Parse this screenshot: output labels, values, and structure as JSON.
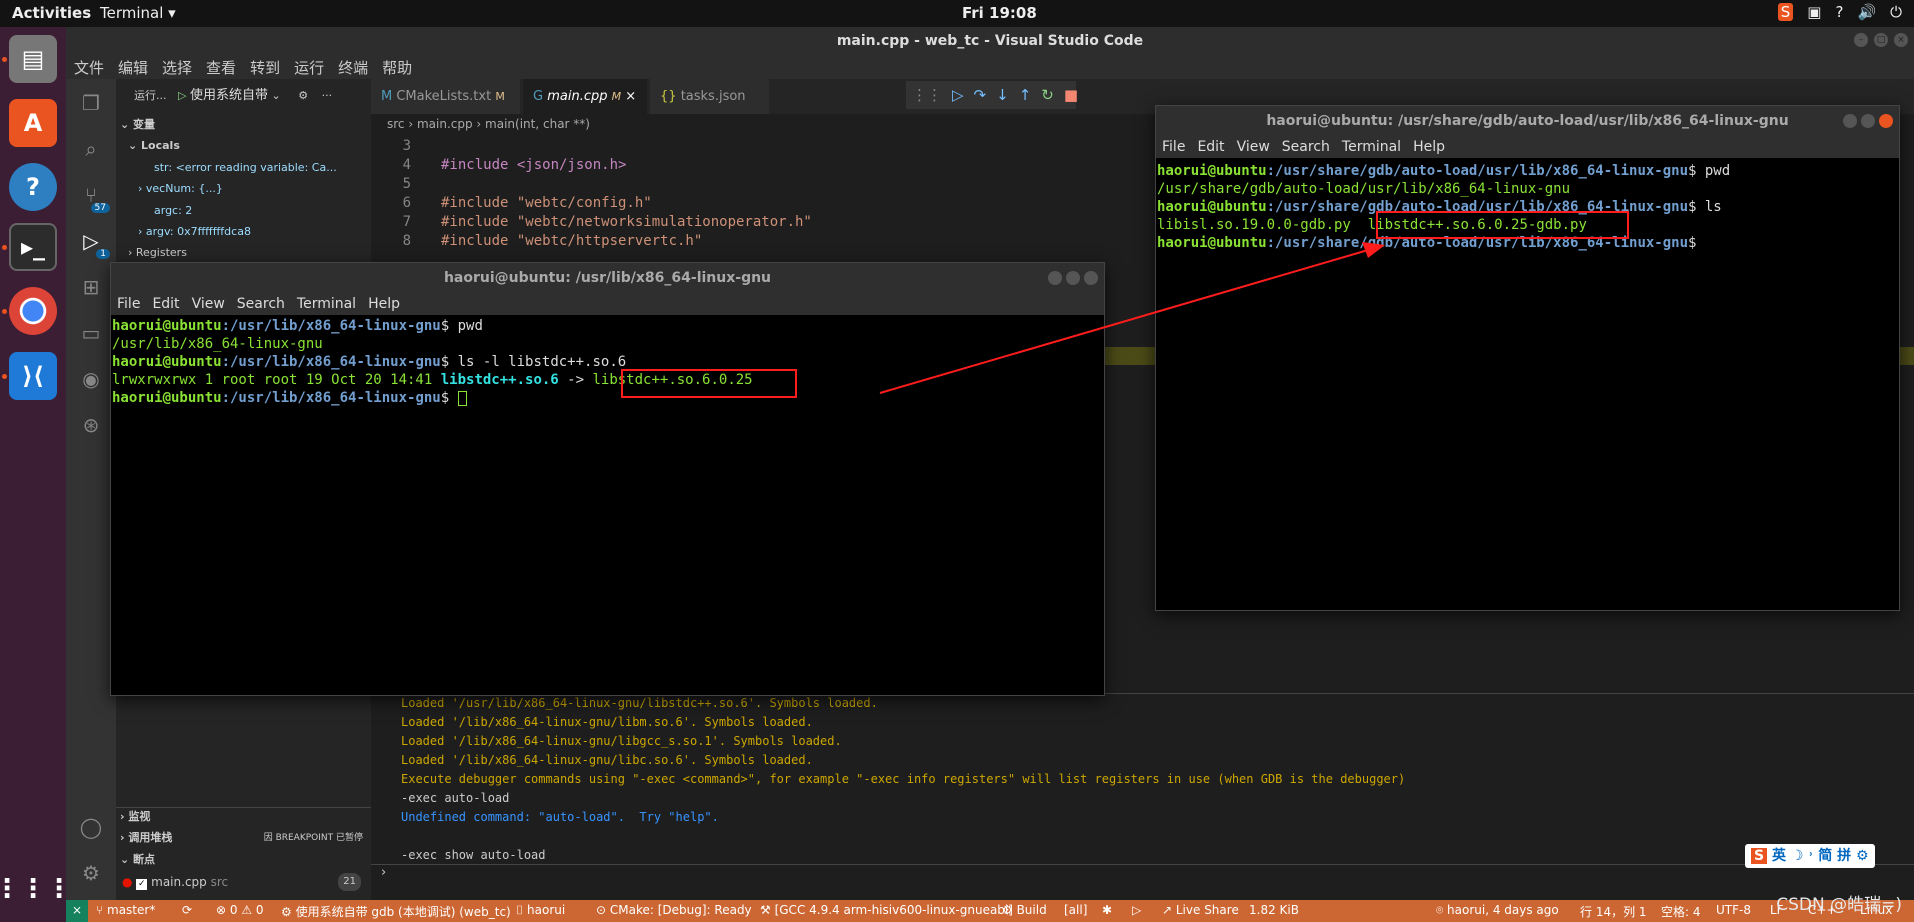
{
  "topbar": {
    "activities": "Activities",
    "app_menu": "Terminal ▾",
    "clock": "Fri 19:08",
    "tray": [
      "S",
      "▣",
      "?",
      "🔊",
      "⏻"
    ]
  },
  "vscode": {
    "title": "main.cpp - web_tc - Visual Studio Code",
    "menu": [
      "文件",
      "编辑",
      "选择",
      "查看",
      "转到",
      "运行",
      "终端",
      "帮助"
    ],
    "sidebar": {
      "run_label": "运行...",
      "config": "使用系统自带",
      "variables": "变量",
      "locals": "Locals",
      "vars": [
        "str: <error reading variable: Ca...",
        "vecNum: {...}",
        "argc: 2",
        "argv: 0x7fffffffdca8"
      ],
      "registers": "Registers",
      "watch": "监视",
      "callstack": "调用堆栈",
      "callstack_status": "因 BREAKPOINT 已暂停",
      "breakpoints": "断点",
      "bp_file": "main.cpp",
      "bp_dir": "src",
      "bp_line": "21"
    },
    "tabs": [
      {
        "label": "CMakeLists.txt",
        "mark": "M"
      },
      {
        "label": "main.cpp",
        "mark": "M"
      },
      {
        "label": "tasks.json",
        "mark": ""
      }
    ],
    "breadcrumb": [
      "src",
      "main.cpp",
      "main(int, char **)"
    ],
    "code": [
      {
        "n": "3",
        "t": ""
      },
      {
        "n": "4",
        "t": "#include <json/json.h>"
      },
      {
        "n": "5",
        "t": ""
      },
      {
        "n": "6",
        "t": "#include \"webtc/config.h\""
      },
      {
        "n": "7",
        "t": "#include \"webtc/networksimulationoperator.h\""
      },
      {
        "n": "8",
        "t": "#include \"webtc/httpservertc.h\""
      }
    ],
    "console": [
      "Loaded '/usr/lib/x86_64-linux-gnu/libstdc++.so.6'. Symbols loaded.",
      "Loaded '/lib/x86_64-linux-gnu/libm.so.6'. Symbols loaded.",
      "Loaded '/lib/x86_64-linux-gnu/libgcc_s.so.1'. Symbols loaded.",
      "Loaded '/lib/x86_64-linux-gnu/libc.so.6'. Symbols loaded.",
      "Execute debugger commands using \"-exec <command>\", for example \"-exec info registers\" will list registers in use (when GDB is the debugger)",
      "-exec auto-load",
      "Undefined command: \"auto-load\".  Try \"help\".",
      "",
      "-exec show auto-load"
    ],
    "status": {
      "branch": "master*",
      "problems": "⊗ 0 ⚠ 0",
      "debug": "使用系统自带 gdb (本地调试) (web_tc)",
      "user": "haorui",
      "cmake": "CMake: [Debug]: Ready",
      "kit": "[GCC 4.9.4 arm-hisiv600-linux-gnueabi]",
      "build": "Build",
      "target": "[all]",
      "liveshare": "Live Share",
      "size": "1.82 KiB",
      "blame": "haorui, 4 days ago",
      "pos": "行 14，列 1",
      "spaces": "空格: 4",
      "enc": "UTF-8",
      "eol": "LF",
      "lang": "C++",
      "os": "Linux"
    }
  },
  "term1": {
    "title": "haorui@ubuntu: /usr/lib/x86_64-linux-gnu",
    "menu": [
      "File",
      "Edit",
      "View",
      "Search",
      "Terminal",
      "Help"
    ],
    "prompt_user": "haorui@ubuntu",
    "cwd": ":/usr/lib/x86_64-linux-gnu",
    "cmd1": " pwd",
    "out1": "/usr/lib/x86_64-linux-gnu",
    "cmd2": " ls -l libstdc++.so.6",
    "ls_meta": "lrwxrwxrwx 1 root root 19 Oct 20 14:41 ",
    "ls_link": "libstdc++.so.6",
    "ls_arrow": " -> ",
    "ls_target": "libstdc++.so.6.0.25"
  },
  "term2": {
    "title": "haorui@ubuntu: /usr/share/gdb/auto-load/usr/lib/x86_64-linux-gnu",
    "menu": [
      "File",
      "Edit",
      "View",
      "Search",
      "Terminal",
      "Help"
    ],
    "prompt_user": "haorui@ubuntu",
    "cwd": ":/usr/share/gdb/auto-load/usr/lib/x86_64-linux-gnu",
    "cmd1": " pwd",
    "out1": "/usr/share/gdb/auto-load/usr/lib/x86_64-linux-gnu",
    "cmd2": " ls",
    "file1": "libisl.so.19.0.0-gdb.py",
    "file2": "libstdc++.so.6.0.25-gdb.py"
  },
  "ime": {
    "labels": "英 ☽ ˒ 简 拼 ⚙"
  },
  "watermark": "CSDN @皓瑞=)"
}
